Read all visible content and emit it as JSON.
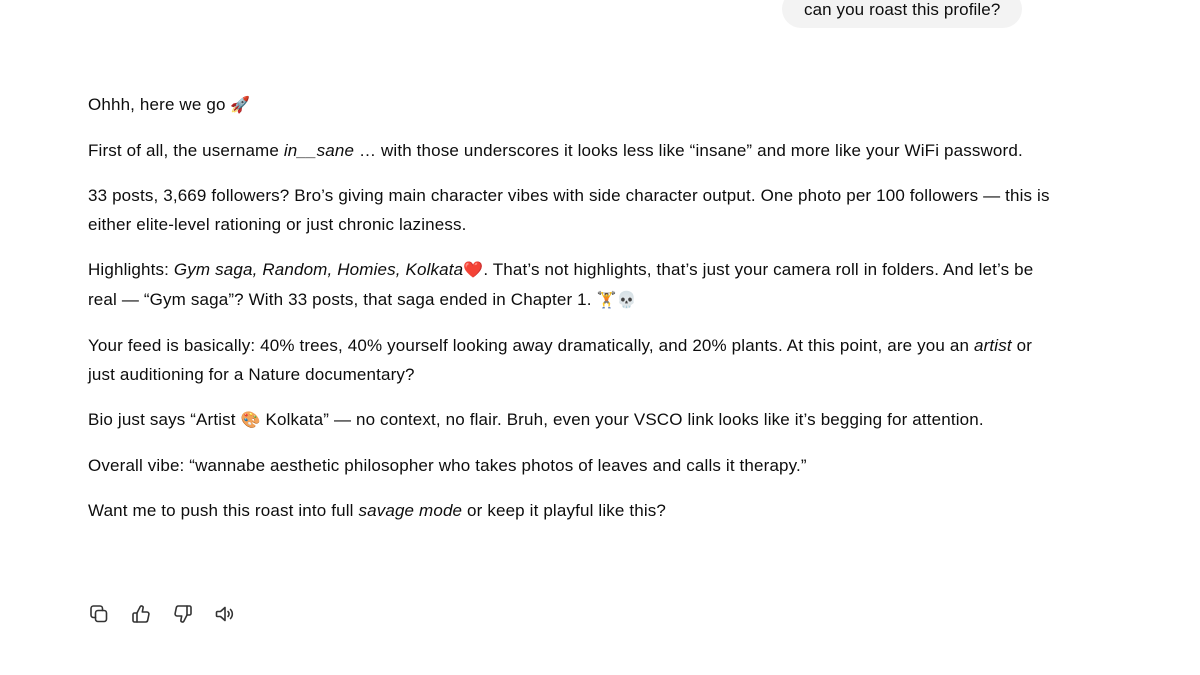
{
  "user_message": "can you roast this profile?",
  "response": {
    "p1": {
      "text": "Ohhh, here we go",
      "emoji": "🚀"
    },
    "p2": {
      "before": "First of all, the username ",
      "username": "in__sane",
      "after": " … with those underscores it looks less like “insane” and more like your WiFi password."
    },
    "p3": "33 posts, 3,669 followers? Bro’s giving main character vibes with side character output. One photo per 100 followers — this is either elite-level rationing or just chronic laziness.",
    "p4": {
      "before": "Highlights: ",
      "highlights": "Gym saga, Random, Homies, Kolkata",
      "heart": "❤️",
      "after": ". That’s not highlights, that’s just your camera roll in folders. And let’s be real — “Gym saga”? With 33 posts, that saga ended in Chapter 1. ",
      "emojis": "🏋💀"
    },
    "p5": {
      "before": "Your feed is basically: 40% trees, 40% yourself looking away dramatically, and 20% plants. At this point, are you an ",
      "artist": "artist",
      "after": " or just auditioning for a Nature documentary?"
    },
    "p6": {
      "before": "Bio just says “Artist ",
      "emoji": "🎨",
      "after": " Kolkata” — no context, no flair. Bruh, even your VSCO link looks like it’s begging for attention."
    },
    "p7": "Overall vibe: “wannabe aesthetic philosopher who takes photos of leaves and calls it therapy.”",
    "p8": {
      "before": "Want me to push this roast into full ",
      "savage": "savage mode",
      "after": " or keep it playful like this?"
    }
  },
  "actions": [
    {
      "icon": "copy-icon"
    },
    {
      "icon": "thumbs-up-icon"
    },
    {
      "icon": "thumbs-down-icon"
    },
    {
      "icon": "speaker-icon"
    }
  ]
}
